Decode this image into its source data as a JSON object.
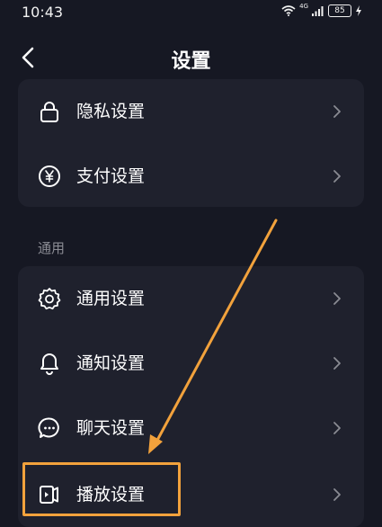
{
  "status_bar": {
    "time": "10:43",
    "network": "4G",
    "battery": "85"
  },
  "header": {
    "title": "设置"
  },
  "card_top": {
    "items": [
      {
        "label": "隐私设置",
        "icon": "lock-icon"
      },
      {
        "label": "支付设置",
        "icon": "yen-icon"
      }
    ]
  },
  "section_general": {
    "title": "通用",
    "items": [
      {
        "label": "通用设置",
        "icon": "gear-icon"
      },
      {
        "label": "通知设置",
        "icon": "bell-icon"
      },
      {
        "label": "聊天设置",
        "icon": "chat-bubble-icon"
      },
      {
        "label": "播放设置",
        "icon": "play-settings-icon"
      }
    ]
  },
  "colors": {
    "background": "#161823",
    "card": "#1f212d",
    "annotation": "#f2a23c",
    "secondary_text": "#8a8b93"
  }
}
